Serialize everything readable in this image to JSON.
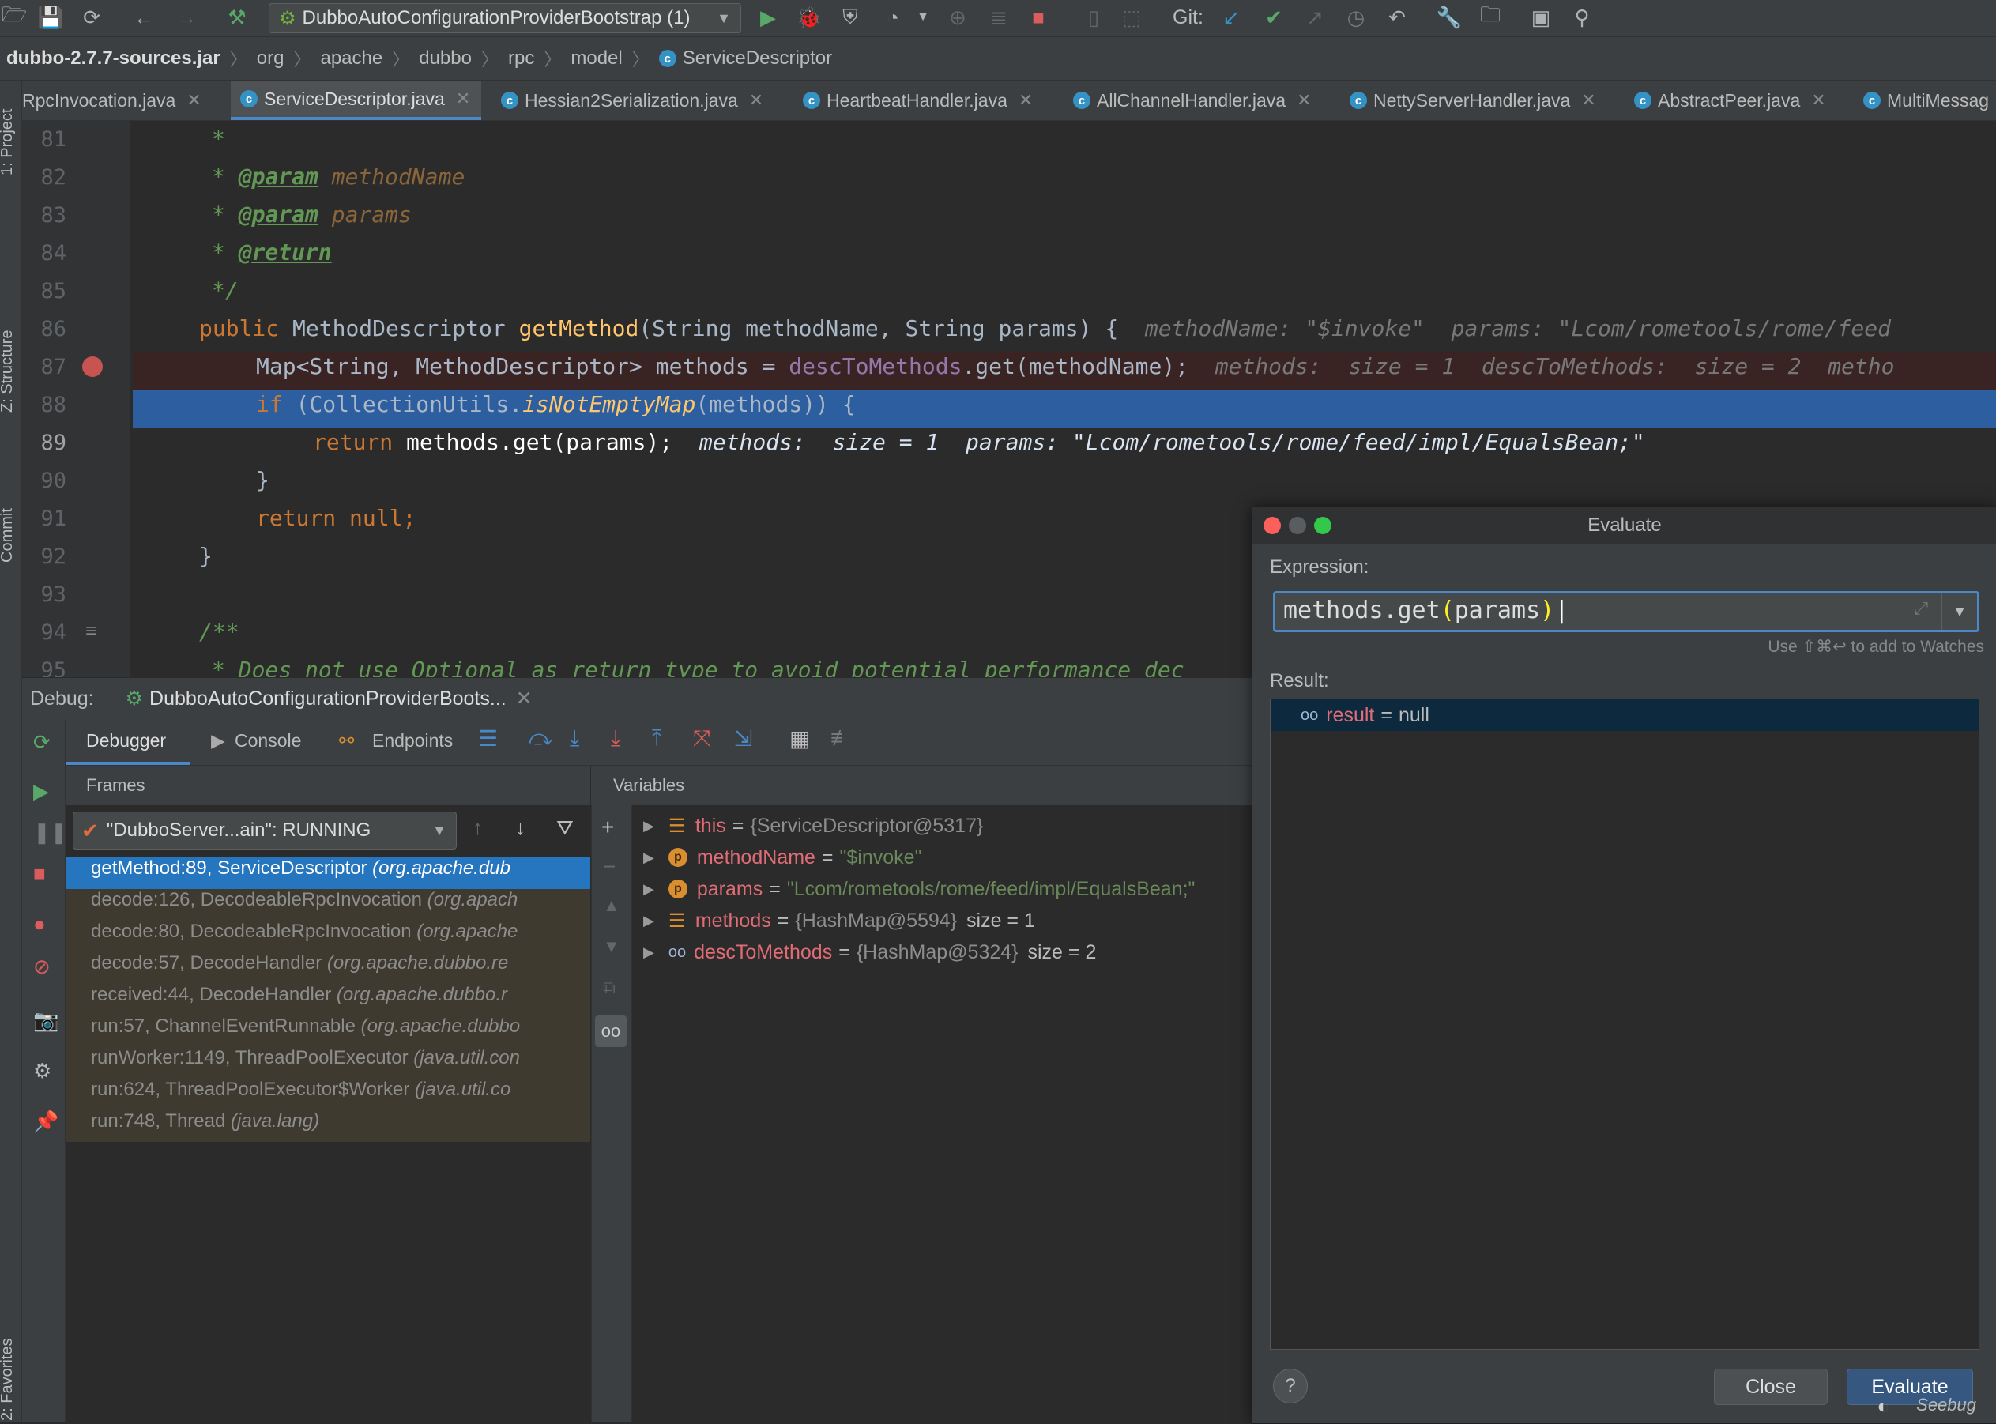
{
  "toolbar": {
    "run_config": "DubboAutoConfigurationProviderBootstrap (1)",
    "git_label": "Git:",
    "icons": [
      "folder-icon",
      "save-icon",
      "sync-icon",
      "back-arrow-icon",
      "forward-arrow-icon",
      "hammer-icon",
      "run-icon",
      "debug-icon",
      "coverage-icon",
      "profile-icon",
      "stop-icon",
      "git-update-icon",
      "git-commit-icon",
      "git-push-icon",
      "history-icon",
      "revert-icon",
      "wrench-icon",
      "project-structure-icon",
      "terminal-icon",
      "search-icon"
    ]
  },
  "breadcrumb": [
    "dubbo-2.7.7-sources.jar",
    "org",
    "apache",
    "dubbo",
    "rpc",
    "model",
    "ServiceDescriptor"
  ],
  "tabs": [
    {
      "label": "RpcInvocation.java",
      "active": false
    },
    {
      "label": "ServiceDescriptor.java",
      "active": true
    },
    {
      "label": "Hessian2Serialization.java",
      "active": false
    },
    {
      "label": "HeartbeatHandler.java",
      "active": false
    },
    {
      "label": "AllChannelHandler.java",
      "active": false
    },
    {
      "label": "NettyServerHandler.java",
      "active": false
    },
    {
      "label": "AbstractPeer.java",
      "active": false
    },
    {
      "label": "MultiMessag",
      "active": false
    }
  ],
  "side_labels": {
    "project": "1: Project",
    "structure": "Z: Structure",
    "commit": "Commit",
    "favorites": "2: Favorites"
  },
  "editor": {
    "line_numbers": [
      "81",
      "82",
      "83",
      "84",
      "85",
      "86",
      "87",
      "88",
      "89",
      "90",
      "91",
      "92",
      "93",
      "94",
      "95"
    ],
    "current_line": "89",
    "code": {
      "l81": "*",
      "l82_tag": "@param",
      "l82_name": "methodName",
      "l83_tag": "@param",
      "l83_name": "params",
      "l84_tag": "@return",
      "l85": "*/",
      "l86_kw": "public",
      "l86_type": "MethodDescriptor",
      "l86_fn": "getMethod",
      "l86_rest": "(String methodName, String params) {",
      "l86_inline": "methodName: \"$invoke\"  params: \"Lcom/rometools/rome/feed",
      "l87_a": "Map<String, MethodDescriptor> methods = ",
      "l87_field": "descToMethods",
      "l87_b": ".get(methodName);",
      "l87_inline": "methods:  size = 1  descToMethods:  size = 2  metho",
      "l88_kw": "if",
      "l88_a": " (CollectionUtils.",
      "l88_fn": "isNotEmptyMap",
      "l88_b": "(methods)) {",
      "l89_kw": "return",
      "l89_a": " methods.get(params);",
      "l89_inline": "methods:  size = 1  params: \"Lcom/rometools/rome/feed/impl/EqualsBean;\"",
      "l90": "}",
      "l91_kw": "return",
      "l91_a": " null;",
      "l92": "}",
      "l94": "/**",
      "l95": "* Does not use Optional as return type to avoid potential performance dec"
    }
  },
  "debug": {
    "label": "Debug:",
    "session": "DubboAutoConfigurationProviderBoots...",
    "tabs": {
      "debugger": "Debugger",
      "console": "Console",
      "endpoints": "Endpoints"
    },
    "frames_header": "Frames",
    "variables_header": "Variables",
    "thread": "\"DubboServer...ain\": RUNNING",
    "frames": [
      {
        "method": "getMethod:89, ServiceDescriptor",
        "loc": "(org.apache.dub",
        "selected": true
      },
      {
        "method": "decode:126, DecodeableRpcInvocation",
        "loc": "(org.apach",
        "selected": false
      },
      {
        "method": "decode:80, DecodeableRpcInvocation",
        "loc": "(org.apache",
        "selected": false
      },
      {
        "method": "decode:57, DecodeHandler",
        "loc": "(org.apache.dubbo.re",
        "selected": false
      },
      {
        "method": "received:44, DecodeHandler",
        "loc": "(org.apache.dubbo.r",
        "selected": false
      },
      {
        "method": "run:57, ChannelEventRunnable",
        "loc": "(org.apache.dubbo",
        "selected": false
      },
      {
        "method": "runWorker:1149, ThreadPoolExecutor",
        "loc": "(java.util.con",
        "selected": false
      },
      {
        "method": "run:624, ThreadPoolExecutor$Worker",
        "loc": "(java.util.co",
        "selected": false
      },
      {
        "method": "run:748, Thread",
        "loc": "(java.lang)",
        "selected": false
      }
    ],
    "variables": [
      {
        "name": "this",
        "value": "{ServiceDescriptor@5317}",
        "size": ""
      },
      {
        "name": "methodName",
        "value": "\"$invoke\"",
        "size": ""
      },
      {
        "name": "params",
        "value": "\"Lcom/rometools/rome/feed/impl/EqualsBean;\"",
        "size": ""
      },
      {
        "name": "methods",
        "value": "{HashMap@5594}",
        "size": "size = 1"
      },
      {
        "name": "descToMethods",
        "value": "{HashMap@5324}",
        "size": "size = 2"
      }
    ]
  },
  "evaluate": {
    "title": "Evaluate",
    "expression_label": "Expression:",
    "expression_a": "methods.get",
    "expression_b": "(",
    "expression_c": "params",
    "expression_d": ")",
    "hint": "Use ⇧⌘↩ to add to Watches",
    "result_label": "Result:",
    "result_name": "result",
    "result_value": "null",
    "close_label": "Close",
    "evaluate_label": "Evaluate",
    "help": "?",
    "watermark": "Seebug"
  },
  "colors": {
    "accent": "#4a88c7",
    "selection": "#2675bf",
    "execution_line": "#2d5fa0",
    "breakpoint_line": "#3a2323"
  }
}
